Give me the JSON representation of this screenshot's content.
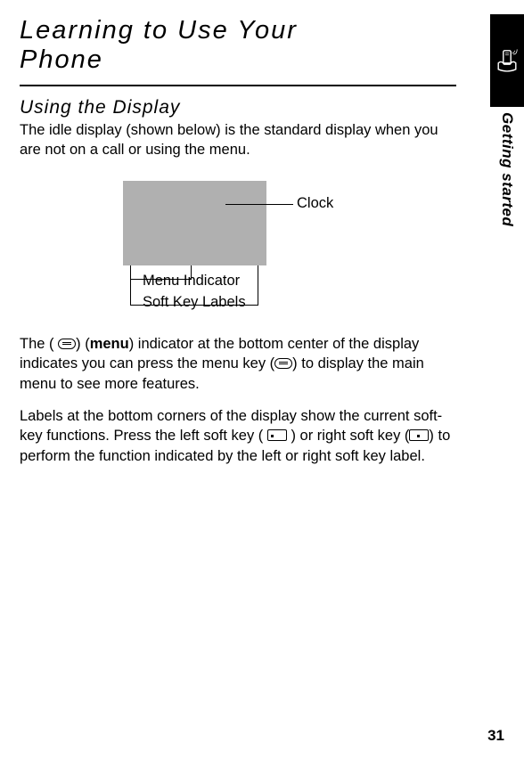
{
  "page": {
    "title_line1": "Learning to Use Your",
    "title_line2": "Phone",
    "section_heading": "Using the Display",
    "intro": "The idle display (shown below) is the standard display when you are not on a call or using the menu.",
    "diagram": {
      "clock": "Clock",
      "menu_indicator": "Menu Indicator",
      "soft_key_labels": "Soft Key Labels"
    },
    "para2_a": "The (",
    "para2_b": ") (",
    "para2_menu": "menu",
    "para2_c": ") indicator at the bottom center of the display indicates you can press the menu key (",
    "para2_d": ") to display the main menu to see more features.",
    "para3_a": "Labels at the bottom corners of the display show the current soft-key functions. Press the left soft key (",
    "para3_b": ") or right soft key (",
    "para3_c": ") to perform the function indicated by the left or right soft key label.",
    "page_number": "31"
  },
  "sidebar": {
    "label": "Getting started"
  }
}
